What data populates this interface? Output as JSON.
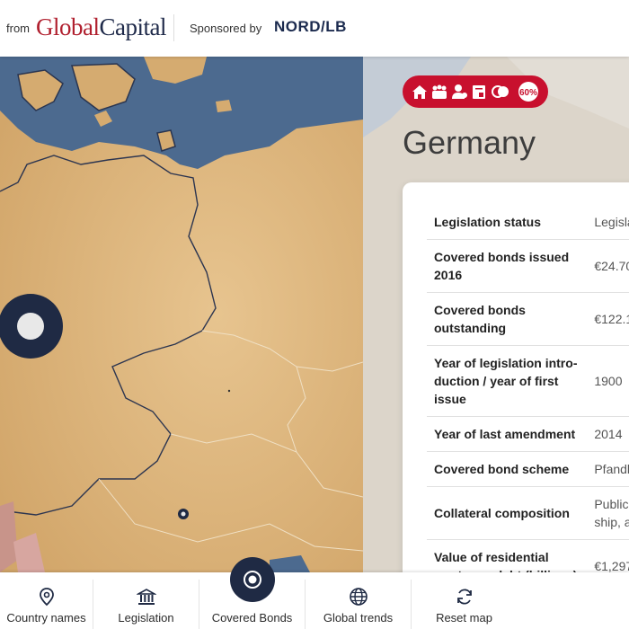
{
  "header": {
    "from_label": "from",
    "brand_part1": "Global",
    "brand_part2": "Capital",
    "sponsored_label": "Sponsored by",
    "sponsor_name": "NORD/LB",
    "brand_color": "#b01f2e",
    "brand_dark_color": "#1f2a4a"
  },
  "country": {
    "name": "Germany",
    "badge_icons": [
      "home-icon",
      "people-icon",
      "person-icon",
      "document-icon",
      "circles-icon",
      "60-percent-icon"
    ],
    "badge_percent_text": "60%",
    "badge_color": "#c8102e"
  },
  "table": {
    "rows": [
      {
        "label": "Legislation status",
        "value": "Legisla"
      },
      {
        "label": "Covered bonds issued 2016",
        "value": "€24.70"
      },
      {
        "label": "Covered bonds outstanding",
        "value": "€122.1"
      },
      {
        "label": "Year of legislation intro­duction / year of first issue",
        "value": "1900"
      },
      {
        "label": "Year of last amendment",
        "value": "2014"
      },
      {
        "label": "Covered bond scheme",
        "value": "Pfandb"
      },
      {
        "label": "Collateral composition",
        "value": "Public ship, a"
      },
      {
        "label": "Value of residential mort­gage debt (billions)",
        "value": "€1,297"
      }
    ]
  },
  "nav": {
    "items": [
      {
        "label": "Country names",
        "icon": "map-pin-icon"
      },
      {
        "label": "Legislation",
        "icon": "bank-icon"
      },
      {
        "label": "Covered Bonds",
        "icon": "target-icon"
      },
      {
        "label": "Global trends",
        "icon": "globe-icon"
      },
      {
        "label": "Reset map",
        "icon": "refresh-icon"
      }
    ]
  },
  "colors": {
    "land": "#d9b27a",
    "sea": "#4c6a8f",
    "marker": "#1f2a44",
    "nav_active": "#1f2a44"
  }
}
